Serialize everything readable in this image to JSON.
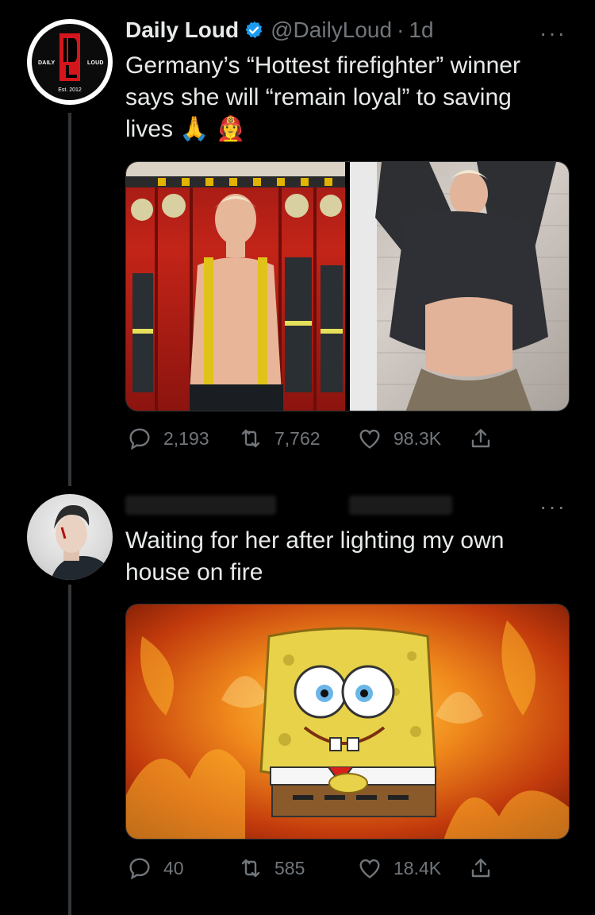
{
  "tweet1": {
    "author_name": "Daily Loud",
    "handle": "@DailyLoud",
    "time_sep": "·",
    "time": "1d",
    "more": "···",
    "text_line1": "Germany’s “Hottest firefighter” winner",
    "text_line2": "says she will “remain loyal” to saving",
    "text_line3": "lives 🙏 👩‍🚒",
    "avatar_logo_left": "DAILY",
    "avatar_logo_right": "LOUD",
    "avatar_logo_est": "Est. 2012",
    "actions": {
      "replies": "2,193",
      "retweets": "7,762",
      "likes": "98.3K"
    }
  },
  "tweet2": {
    "more": "···",
    "text_line1": "Waiting for her after lighting my own",
    "text_line2": "house on fire",
    "actions": {
      "replies": "40",
      "retweets": "585",
      "likes": "18.4K"
    }
  },
  "colors": {
    "background": "#000000",
    "text": "#e7e9ea",
    "muted": "#71767b",
    "verified": "#1d9bf0",
    "logo_red": "#d4161c"
  }
}
